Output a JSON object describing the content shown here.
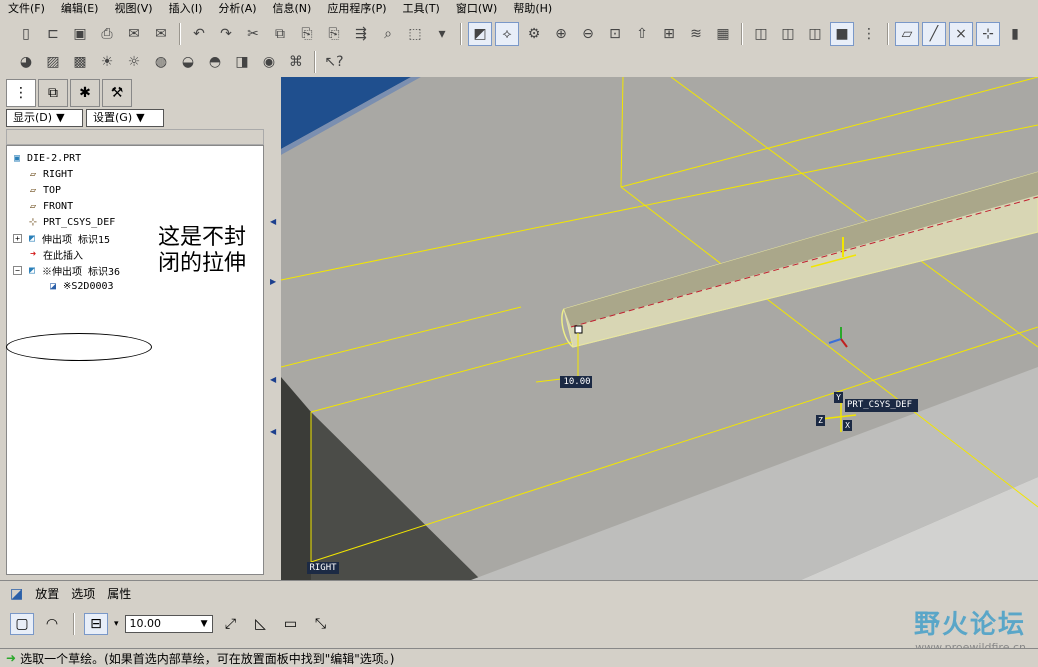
{
  "menu": [
    "文件(F)",
    "编辑(E)",
    "视图(V)",
    "插入(I)",
    "分析(A)",
    "信息(N)",
    "应用程序(P)",
    "工具(T)",
    "窗口(W)",
    "帮助(H)"
  ],
  "panel": {
    "show_label": "显示(D)",
    "settings_label": "设置(G)"
  },
  "tree": {
    "root": "DIE-2.PRT",
    "right": "RIGHT",
    "top": "TOP",
    "front": "FRONT",
    "csys": "PRT_CSYS_DEF",
    "extrude15": "伸出项 标识15",
    "insert_here": "在此插入",
    "extrude36": "※伸出项 标识36",
    "sketch": "※S2D0003"
  },
  "annotation": "这是不封闭的拉伸",
  "viewport": {
    "dim_value": "10.00",
    "csys_label": "PRT_CSYS_DEF",
    "right_label": "RIGHT",
    "x_tag": "X",
    "y_tag": "Y",
    "z_tag": "Z"
  },
  "dashboard": {
    "tabs": [
      "放置",
      "选项",
      "属性"
    ],
    "depth_value": "10.00"
  },
  "status": {
    "message": "选取一个草绘。(如果首选内部草绘，可在放置面板中找到\"编辑\"选项。)"
  },
  "watermark": {
    "title": "野火论坛",
    "url": "www.proewildfire.cn"
  },
  "colors": {
    "viewport_bg": "#a9a8a4",
    "datum_yellow": "#f2e600",
    "model_blue": "#1f4f8e"
  }
}
